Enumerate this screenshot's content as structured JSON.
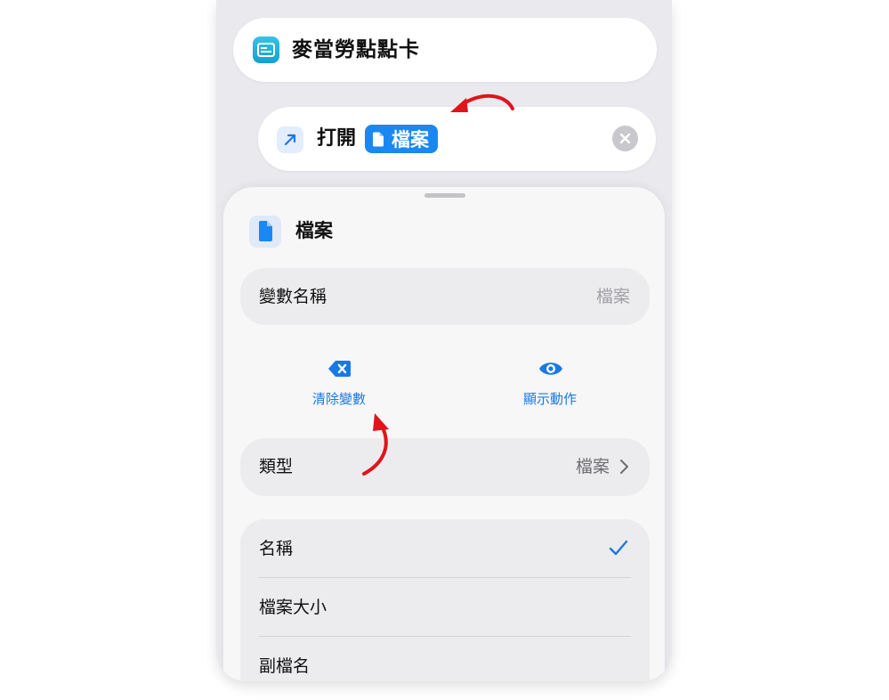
{
  "shortcut": {
    "title": "麥當勞點點卡",
    "icon": "wallet-card-icon",
    "icon_color": "#1ba9d8"
  },
  "action": {
    "verb": "打開",
    "token_label": "檔案",
    "token_icon": "document-icon",
    "token_color": "#1a88f0"
  },
  "sheet": {
    "title": "檔案",
    "icon": "document-icon",
    "variable_name": {
      "label": "變數名稱",
      "value": "檔案"
    },
    "buttons": [
      {
        "label": "清除變數",
        "icon": "clear-backspace-icon"
      },
      {
        "label": "顯示動作",
        "icon": "eye-icon"
      }
    ],
    "type": {
      "label": "類型",
      "value": "檔案"
    },
    "properties": [
      {
        "label": "名稱",
        "selected": true
      },
      {
        "label": "檔案大小",
        "selected": false
      },
      {
        "label": "副檔名",
        "selected": false
      }
    ]
  },
  "colors": {
    "accent": "#1a78e6",
    "annotation": "#e0141b"
  }
}
